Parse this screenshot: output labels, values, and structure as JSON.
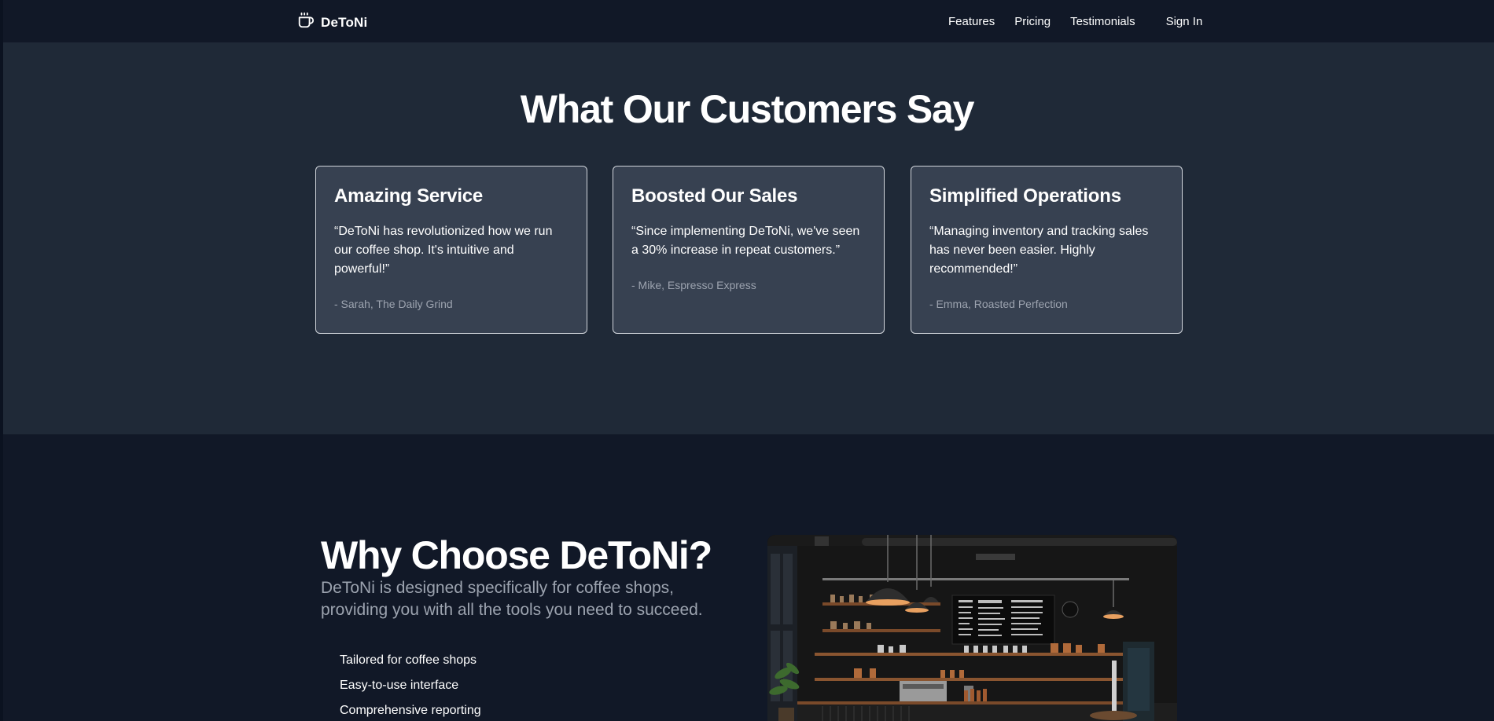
{
  "header": {
    "brand": "DeToNi",
    "nav": [
      "Features",
      "Pricing",
      "Testimonials"
    ],
    "signin": "Sign In"
  },
  "testimonials": {
    "title": "What Our Customers Say",
    "cards": [
      {
        "title": "Amazing Service",
        "quote": "“DeToNi has revolutionized how we run our coffee shop. It's intuitive and powerful!”",
        "author": "- Sarah, The Daily Grind"
      },
      {
        "title": "Boosted Our Sales",
        "quote": "“Since implementing DeToNi, we've seen a 30% increase in repeat customers.”",
        "author": "- Mike, Espresso Express"
      },
      {
        "title": "Simplified Operations",
        "quote": "“Managing inventory and tracking sales has never been easier. Highly recommended!”",
        "author": "- Emma, Roasted Perfection"
      }
    ]
  },
  "why": {
    "title": "Why Choose DeToNi?",
    "subtitle": "DeToNi is designed specifically for coffee shops, providing you with all the tools you need to succeed.",
    "features": [
      "Tailored for coffee shops",
      "Easy-to-use interface",
      "Comprehensive reporting"
    ]
  },
  "colors": {
    "page_bg": "#111827",
    "section_bg": "#1f2937",
    "card_bg": "#374151",
    "muted_text": "#9ca3af"
  },
  "icons": {
    "brand": "coffee-cup-icon"
  }
}
